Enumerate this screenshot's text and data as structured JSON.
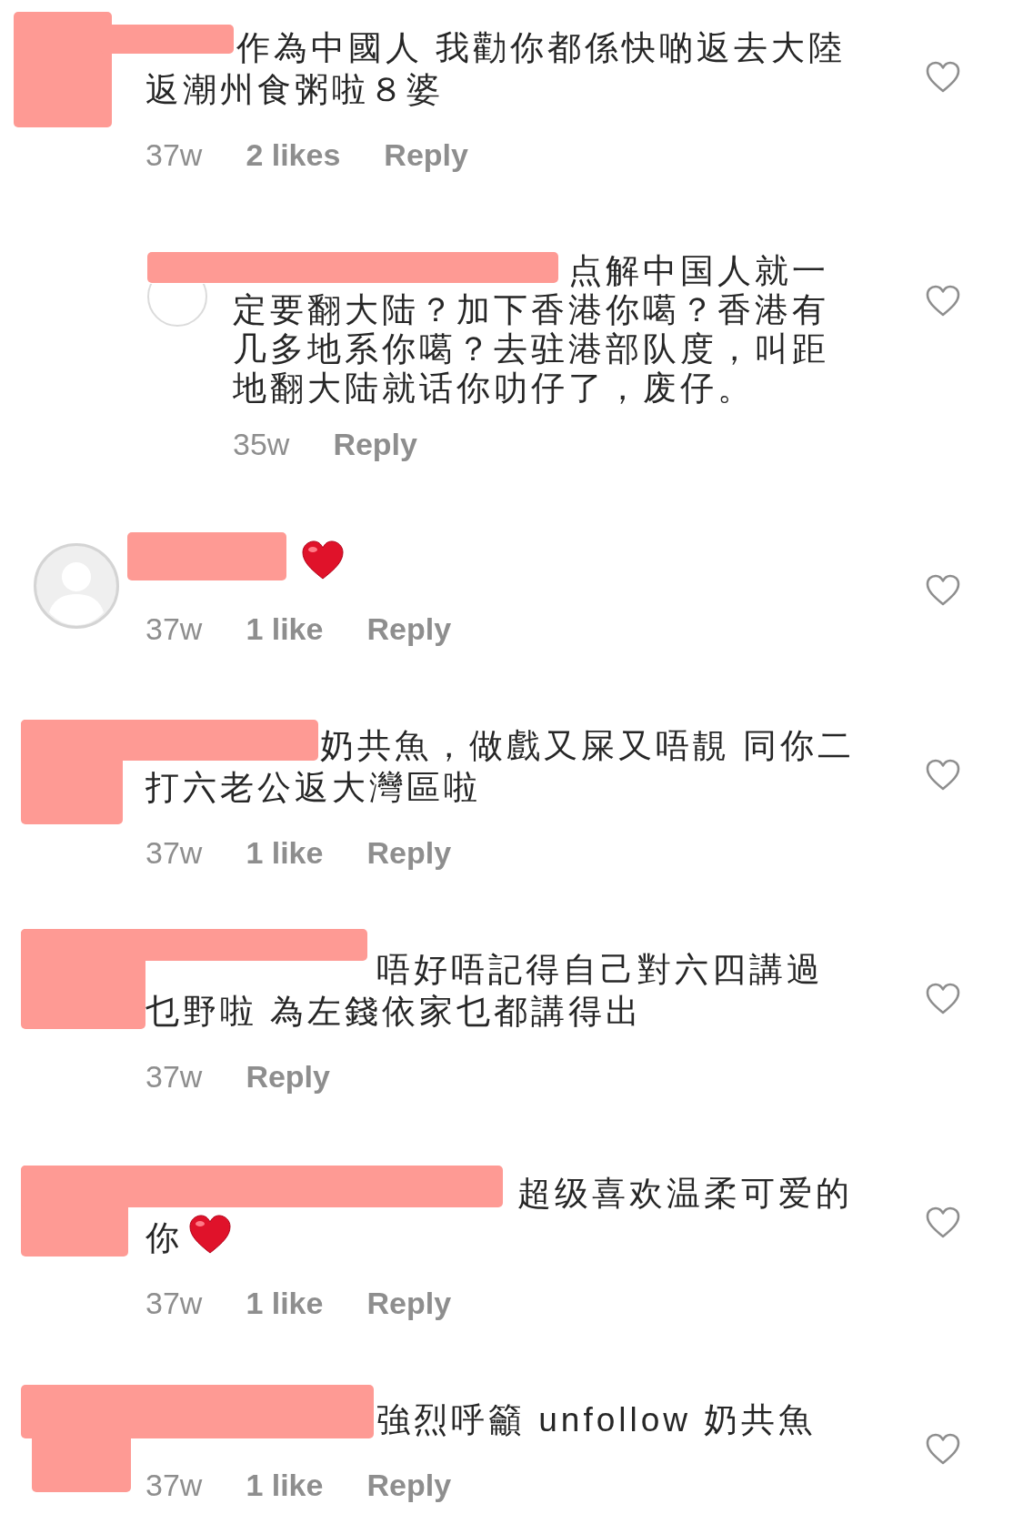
{
  "comments": [
    {
      "kind": "comment",
      "lines": [
        "作為中國人 我勸你都係快啲返去大陸",
        "返潮州食粥啦８婆"
      ],
      "time": "37w",
      "likes": "2 likes",
      "reply": "Reply",
      "liked": false
    },
    {
      "kind": "reply",
      "avatar": true,
      "lines": [
        "点解中国人就一",
        "定要翻大陆？加下香港你噶？香港有",
        "几多地系你噶？去驻港部队度，叫距",
        "地翻大陆就话你叻仔了，废仔。"
      ],
      "time": "35w",
      "reply": "Reply",
      "liked": false
    },
    {
      "kind": "comment",
      "avatar": true,
      "heart_emoji": true,
      "time": "37w",
      "likes": "1 like",
      "reply": "Reply",
      "liked": false
    },
    {
      "kind": "comment",
      "lines": [
        "奶共魚，做戲又屎又唔靚 同你二",
        "打六老公返大灣區啦"
      ],
      "time": "37w",
      "likes": "1 like",
      "reply": "Reply",
      "liked": false
    },
    {
      "kind": "comment",
      "lines": [
        "唔好唔記得自己對六四講過",
        "乜野啦 為左錢依家乜都講得出"
      ],
      "time": "37w",
      "reply": "Reply",
      "liked": false
    },
    {
      "kind": "comment",
      "lines": [
        "超级喜欢温柔可爱的",
        "你"
      ],
      "heart_emoji": true,
      "time": "37w",
      "likes": "1 like",
      "reply": "Reply",
      "liked": false
    },
    {
      "kind": "comment",
      "lines": [
        "強烈呼籲 unfollow 奶共魚"
      ],
      "time": "37w",
      "likes": "1 like",
      "reply": "Reply",
      "liked": false
    }
  ]
}
